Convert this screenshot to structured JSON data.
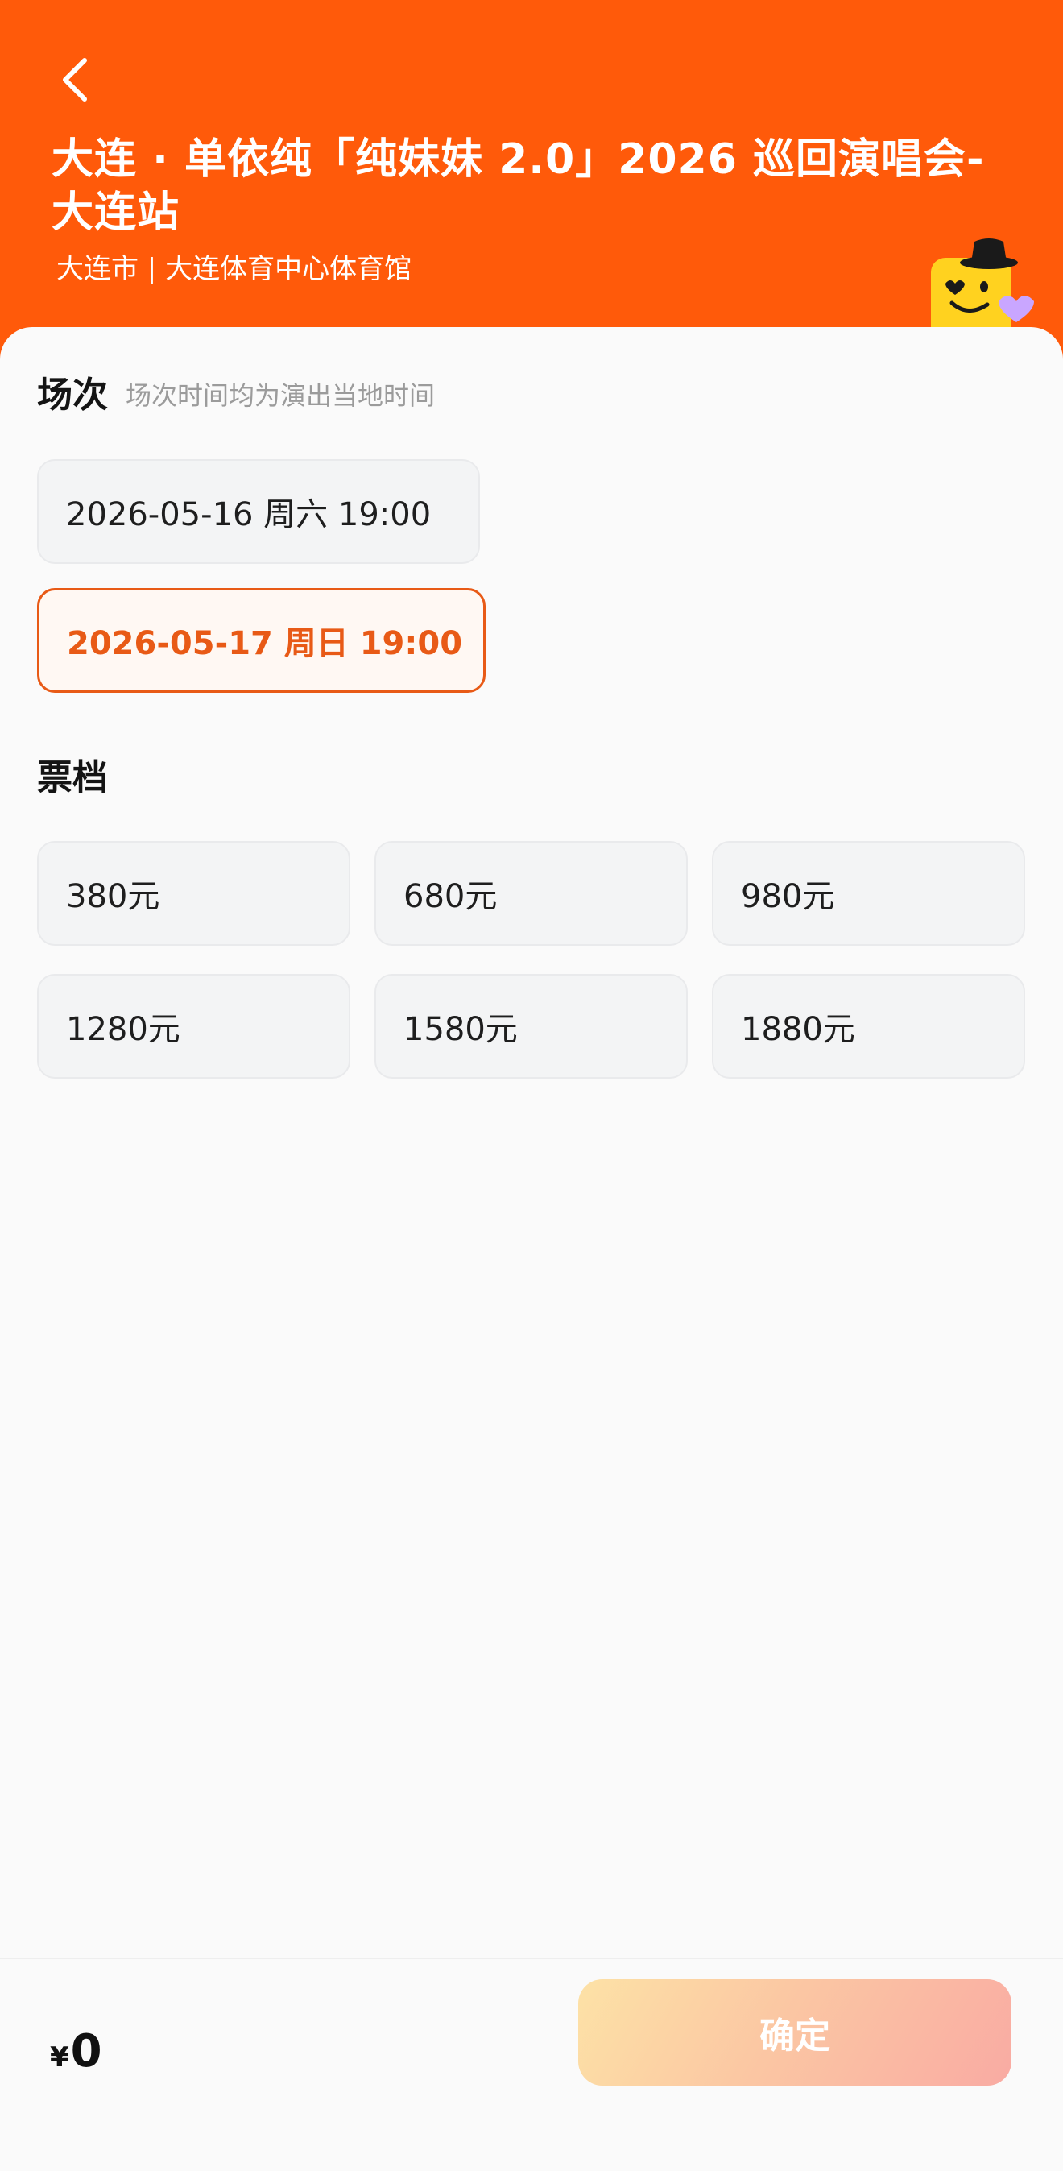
{
  "header": {
    "back_icon": "chevron-left-icon",
    "title": "大连 · 单依纯「纯妹妹 2.0」2026 巡回演唱会-大连站",
    "venue": "大连市 | 大连体育中心体育馆",
    "background_color": "#ff5a0a"
  },
  "session_section": {
    "title": "场次",
    "subtitle": "场次时间均为演出当地时间",
    "options": [
      {
        "label": "2026-05-16  周六 19:00",
        "selected": false
      },
      {
        "label": "2026-05-17 周日 19:00",
        "selected": true
      }
    ]
  },
  "ticket_section": {
    "title": "票档",
    "options": [
      {
        "label": "380元"
      },
      {
        "label": "680元"
      },
      {
        "label": "980元"
      },
      {
        "label": "1280元"
      },
      {
        "label": "1580元"
      },
      {
        "label": "1880元"
      }
    ]
  },
  "bottom_bar": {
    "currency_symbol": "¥",
    "total": "0",
    "confirm_label": "确定"
  },
  "colors": {
    "accent": "#e85a16",
    "chip_bg": "#f3f4f5"
  }
}
